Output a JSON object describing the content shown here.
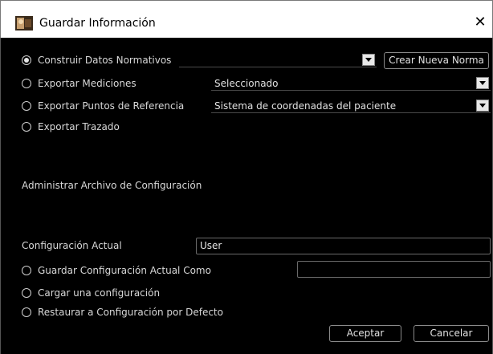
{
  "window": {
    "title": "Guardar Información",
    "close_glyph": "✕",
    "icon": "app-icon"
  },
  "export": {
    "options": [
      {
        "label": "Construir Datos Normativos",
        "checked": true
      },
      {
        "label": "Exportar Mediciones",
        "checked": false
      },
      {
        "label": "Exportar Puntos de Referencia",
        "checked": false
      },
      {
        "label": "Exportar Trazado",
        "checked": false
      }
    ],
    "norm_combo_value": "",
    "new_norm_button": "Crear Nueva Norma",
    "measurements_combo_value": "Seleccionado",
    "landmarks_combo_value": "Sistema de coordenadas del paciente"
  },
  "config": {
    "section_title": "Administrar Archivo de Configuración",
    "current_label": "Configuración Actual",
    "current_value": "User",
    "options": [
      {
        "label": "Guardar Configuración Actual Como",
        "checked": false
      },
      {
        "label": "Cargar una configuración",
        "checked": false
      },
      {
        "label": "Restaurar a Configuración por Defecto",
        "checked": false
      }
    ],
    "save_as_value": ""
  },
  "footer": {
    "accept_button": "Aceptar",
    "cancel_button": "Cancelar"
  }
}
